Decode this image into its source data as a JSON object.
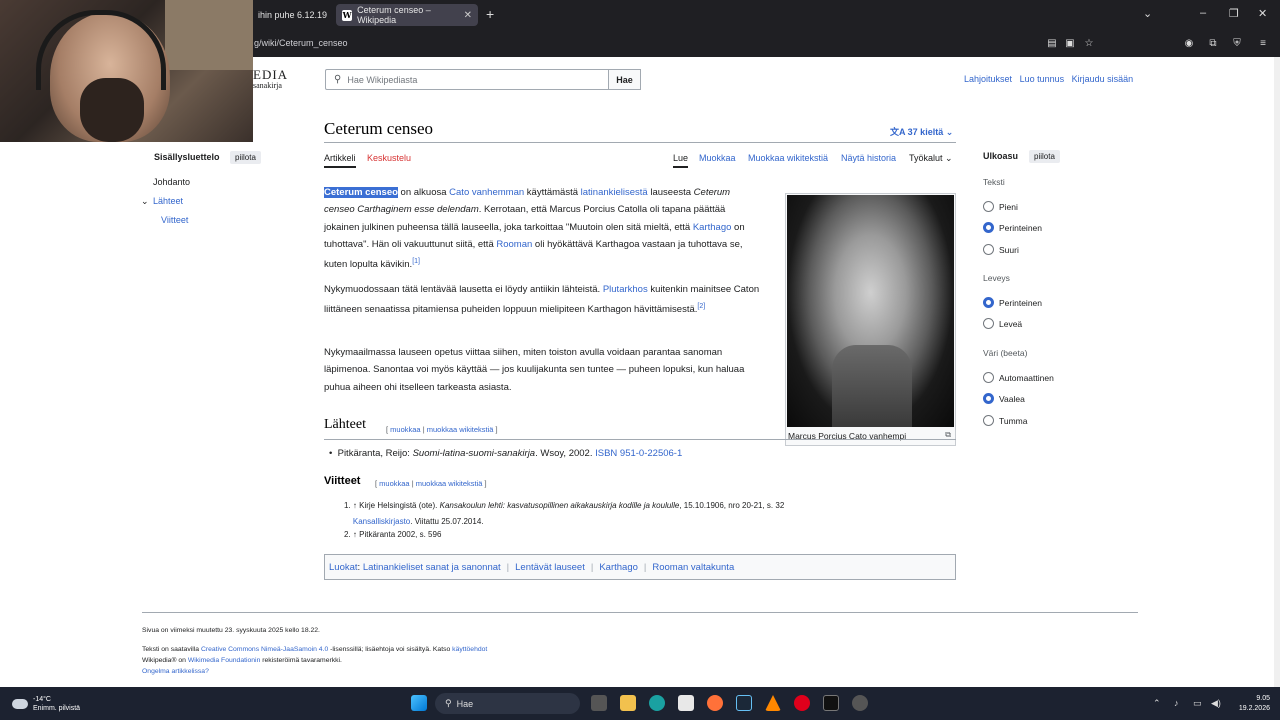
{
  "browser": {
    "tabs": [
      {
        "label": "ihin puhe 6.12.19"
      },
      {
        "label": "Ceterum censeo – Wikipedia",
        "favicon": "W"
      }
    ],
    "url": "g/wiki/Ceterum_censeo"
  },
  "wiki": {
    "logo": "EDIA",
    "logo_sub": "sanakirja",
    "search_placeholder": "Hae Wikipediasta",
    "search_button": "Hae",
    "top_links": [
      "Lahjoitukset",
      "Luo tunnus",
      "Kirjaudu sisään"
    ],
    "title": "Ceterum censeo",
    "languages": "37 kieltä",
    "tabs_left": [
      "Artikkeli",
      "Keskustelu"
    ],
    "tabs_right": [
      "Lue",
      "Muokkaa",
      "Muokkaa wikitekstiä",
      "Näytä historia",
      "Työkalut"
    ]
  },
  "toc": {
    "title": "Sisällysluettelo",
    "hide": "piilota",
    "items": [
      "Johdanto",
      "Lähteet",
      "Viitteet"
    ]
  },
  "article": {
    "p1_hl": "Ceterum censeo",
    "p1_a": " on alkuosa ",
    "p1_l1": "Cato vanhemman",
    "p1_b": " käyttämästä ",
    "p1_l2": "latinankielisestä",
    "p1_c": " lauseesta ",
    "p1_i": "Ceterum censeo Carthaginem esse delendam",
    "p1_d": ". Kerrotaan, että Marcus Porcius Catolla oli tapana päättää jokainen julkinen puheensa tällä lauseella, joka tarkoittaa \"Muutoin olen sitä mieltä, että ",
    "p1_l3": "Karthago",
    "p1_e": " on tuhottava\". Hän oli vakuuttunut siitä, että ",
    "p1_l4": "Rooman",
    "p1_f": " oli hyökättävä Karthagoa vastaan ja tuhottava se, kuten lopulta kävikin.",
    "p1_sup": "[1]",
    "p2_a": "Nykymuodossaan tätä lentävää lausetta ei löydy antiikin lähteistä. ",
    "p2_l1": "Plutarkhos",
    "p2_b": " kuitenkin mainitsee Caton liittäneen senaatissa pitamiensa puheiden loppuun mielipiteen Karthagon hävittämisestä.",
    "p2_sup": "[2]",
    "p3": "Nykymaailmassa lauseen opetus viittaa siihen, miten toiston avulla voidaan parantaa sanoman läpimenoa. Sanontaa voi myös käyttää — jos kuulijakunta sen tuntee — puheen lopuksi, kun haluaa puhua aiheen ohi itselleen tarkeasta asiasta.",
    "caption": "Marcus Porcius Cato vanhempi"
  },
  "sources": {
    "heading": "Lähteet",
    "edit": "muokkaa",
    "edit_wiki": "muokkaa wikitekstiä",
    "item_a": "Pitkäranta, Reijo: ",
    "item_i": "Suomi-latina-suomi-sanakirja",
    "item_b": ". Wsoy, 2002. ",
    "item_l": "ISBN 951-0-22506-1"
  },
  "refs": {
    "heading": "Viitteet",
    "r1_a": "↑ Kirje Helsingistä (ote). ",
    "r1_i": "Kansakoulun lehti: kasvatusopillinen aikakauskirja kodille ja koululle",
    "r1_b": ", 15.10.1906, nro 20-21, s. 32",
    "r1_l": "Kansalliskirjasto",
    "r1_c": ". Viitattu 25.07.2014.",
    "r2": "↑ Pitkäranta 2002, s. 596"
  },
  "categories": {
    "label": "Luokat",
    "items": [
      "Latinankieliset sanat ja sanonnat",
      "Lentävät lauseet",
      "Karthago",
      "Rooman valtakunta"
    ]
  },
  "footer": {
    "modified": "Sivua on viimeksi muutettu 23. syyskuuta 2025 kello 18.22.",
    "lic_a": "Teksti on saatavilla ",
    "lic_l": "Creative Commons Nimeä-JaaSamoin 4.0",
    "lic_b": " -lisenssillä; lisäehtoja voi sisältyä. Katso ",
    "lic_l2": "käyttöehdot",
    "wm_a": "Wikipedia® on ",
    "wm_l": "Wikimedia Foundationin",
    "wm_b": " rekisteröimä tavaramerkki.",
    "problems": "Ongelma artikkelissa?"
  },
  "appearance": {
    "title": "Ulkoasu",
    "hide": "piilota",
    "text_label": "Teksti",
    "text_opts": [
      "Pieni",
      "Perinteinen",
      "Suuri"
    ],
    "width_label": "Leveys",
    "width_opts": [
      "Perinteinen",
      "Leveä"
    ],
    "color_label": "Väri (beeta)",
    "color_opts": [
      "Automaattinen",
      "Vaalea",
      "Tumma"
    ],
    "selected": {
      "text": "Perinteinen",
      "width": "Perinteinen",
      "color": "Vaalea"
    }
  },
  "taskbar": {
    "temp": "-14°C",
    "weather": "Enimm. pilvistä",
    "search": "Hae",
    "time": "9.05",
    "date": "19.2.2026"
  },
  "colors": {
    "link": "#3366cc",
    "red_link": "#d73333",
    "highlight": "#3b6fd4"
  }
}
